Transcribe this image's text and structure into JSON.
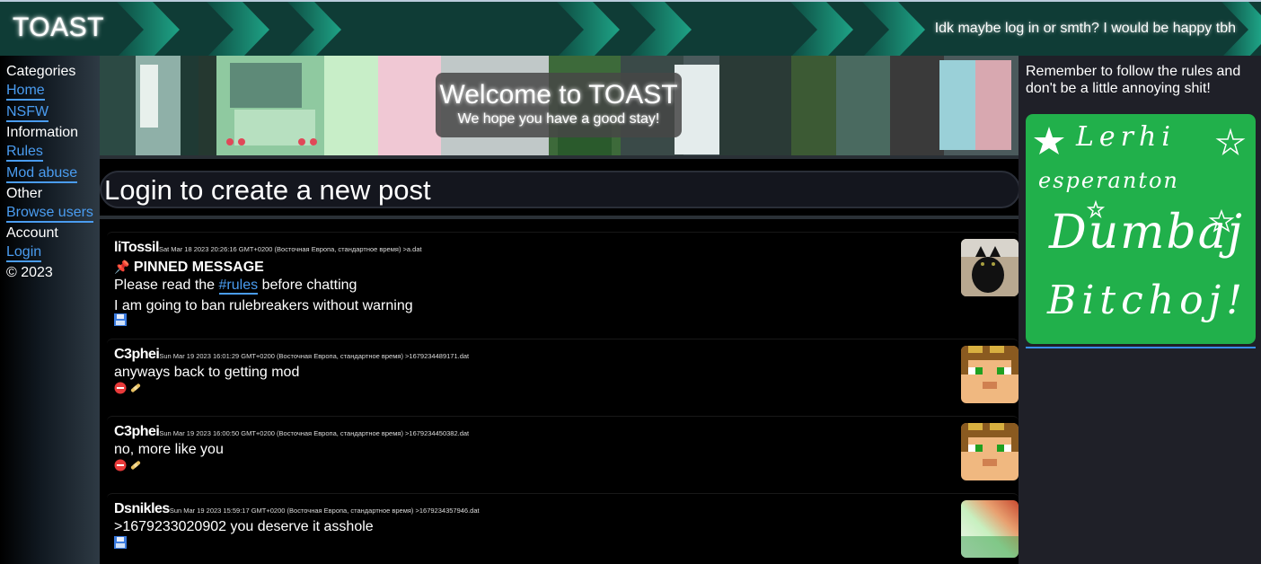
{
  "header": {
    "brand": "TOAST",
    "message": "Idk maybe log in or smth? I would be happy tbh"
  },
  "sidebar": {
    "sections": [
      {
        "heading": "Categories",
        "links": [
          "Home",
          "NSFW"
        ]
      },
      {
        "heading": "Information",
        "links": [
          "Rules",
          "Mod abuse"
        ]
      },
      {
        "heading": "Other",
        "links": [
          "Browse users"
        ]
      },
      {
        "heading": "Account",
        "links": [
          "Login"
        ]
      }
    ],
    "copyright": "© 2023"
  },
  "banner": {
    "title": "Welcome to TOAST",
    "subtitle": "We hope you have a good stay!"
  },
  "login_prompt": "Login to create a new post",
  "posts": [
    {
      "author": "liTossil",
      "meta": "Sat Mar 18 2023 20:26:16 GMT+0200 (Восточная Европа, стандартное время) >a.dat",
      "pinned_label": "PINNED MESSAGE",
      "line1_before": "Please read the",
      "line1_link": "#rules",
      "line1_after": "before chatting",
      "line2": "I am going to ban rulebreakers without warning"
    },
    {
      "author": "C3phei",
      "meta": "Sun Mar 19 2023 16:01:29 GMT+0200 (Восточная Европа, стандартное время) >1679234489171.dat",
      "text": "anyways back to getting mod"
    },
    {
      "author": "C3phei",
      "meta": "Sun Mar 19 2023 16:00:50 GMT+0200 (Восточная Европа, стандартное время) >1679234450382.dat",
      "text": "no, more like you"
    },
    {
      "author": "Dsnikles",
      "meta": "Sun Mar 19 2023 15:59:17 GMT+0200 (Восточная Европа, стандартное время) >1679234357946.dat",
      "text": ">1679233020902 you deserve it asshole"
    }
  ],
  "right_sidebar": {
    "note": "Remember to follow the rules and don't be a little annoying shit!",
    "drawing_lines": [
      "Lerhi",
      "esperanton",
      "Dumbaj",
      "Bitchoj!"
    ]
  },
  "colors": {
    "link": "#4a9cf0",
    "header_bg": "#0e3a34",
    "chevron": "#1a8a72",
    "drawing_bg": "#21b04b"
  },
  "icons": {
    "pin": "pushpin-icon",
    "save": "floppy-disk-icon",
    "delete": "no-entry-icon",
    "ban": "bandage-icon"
  }
}
